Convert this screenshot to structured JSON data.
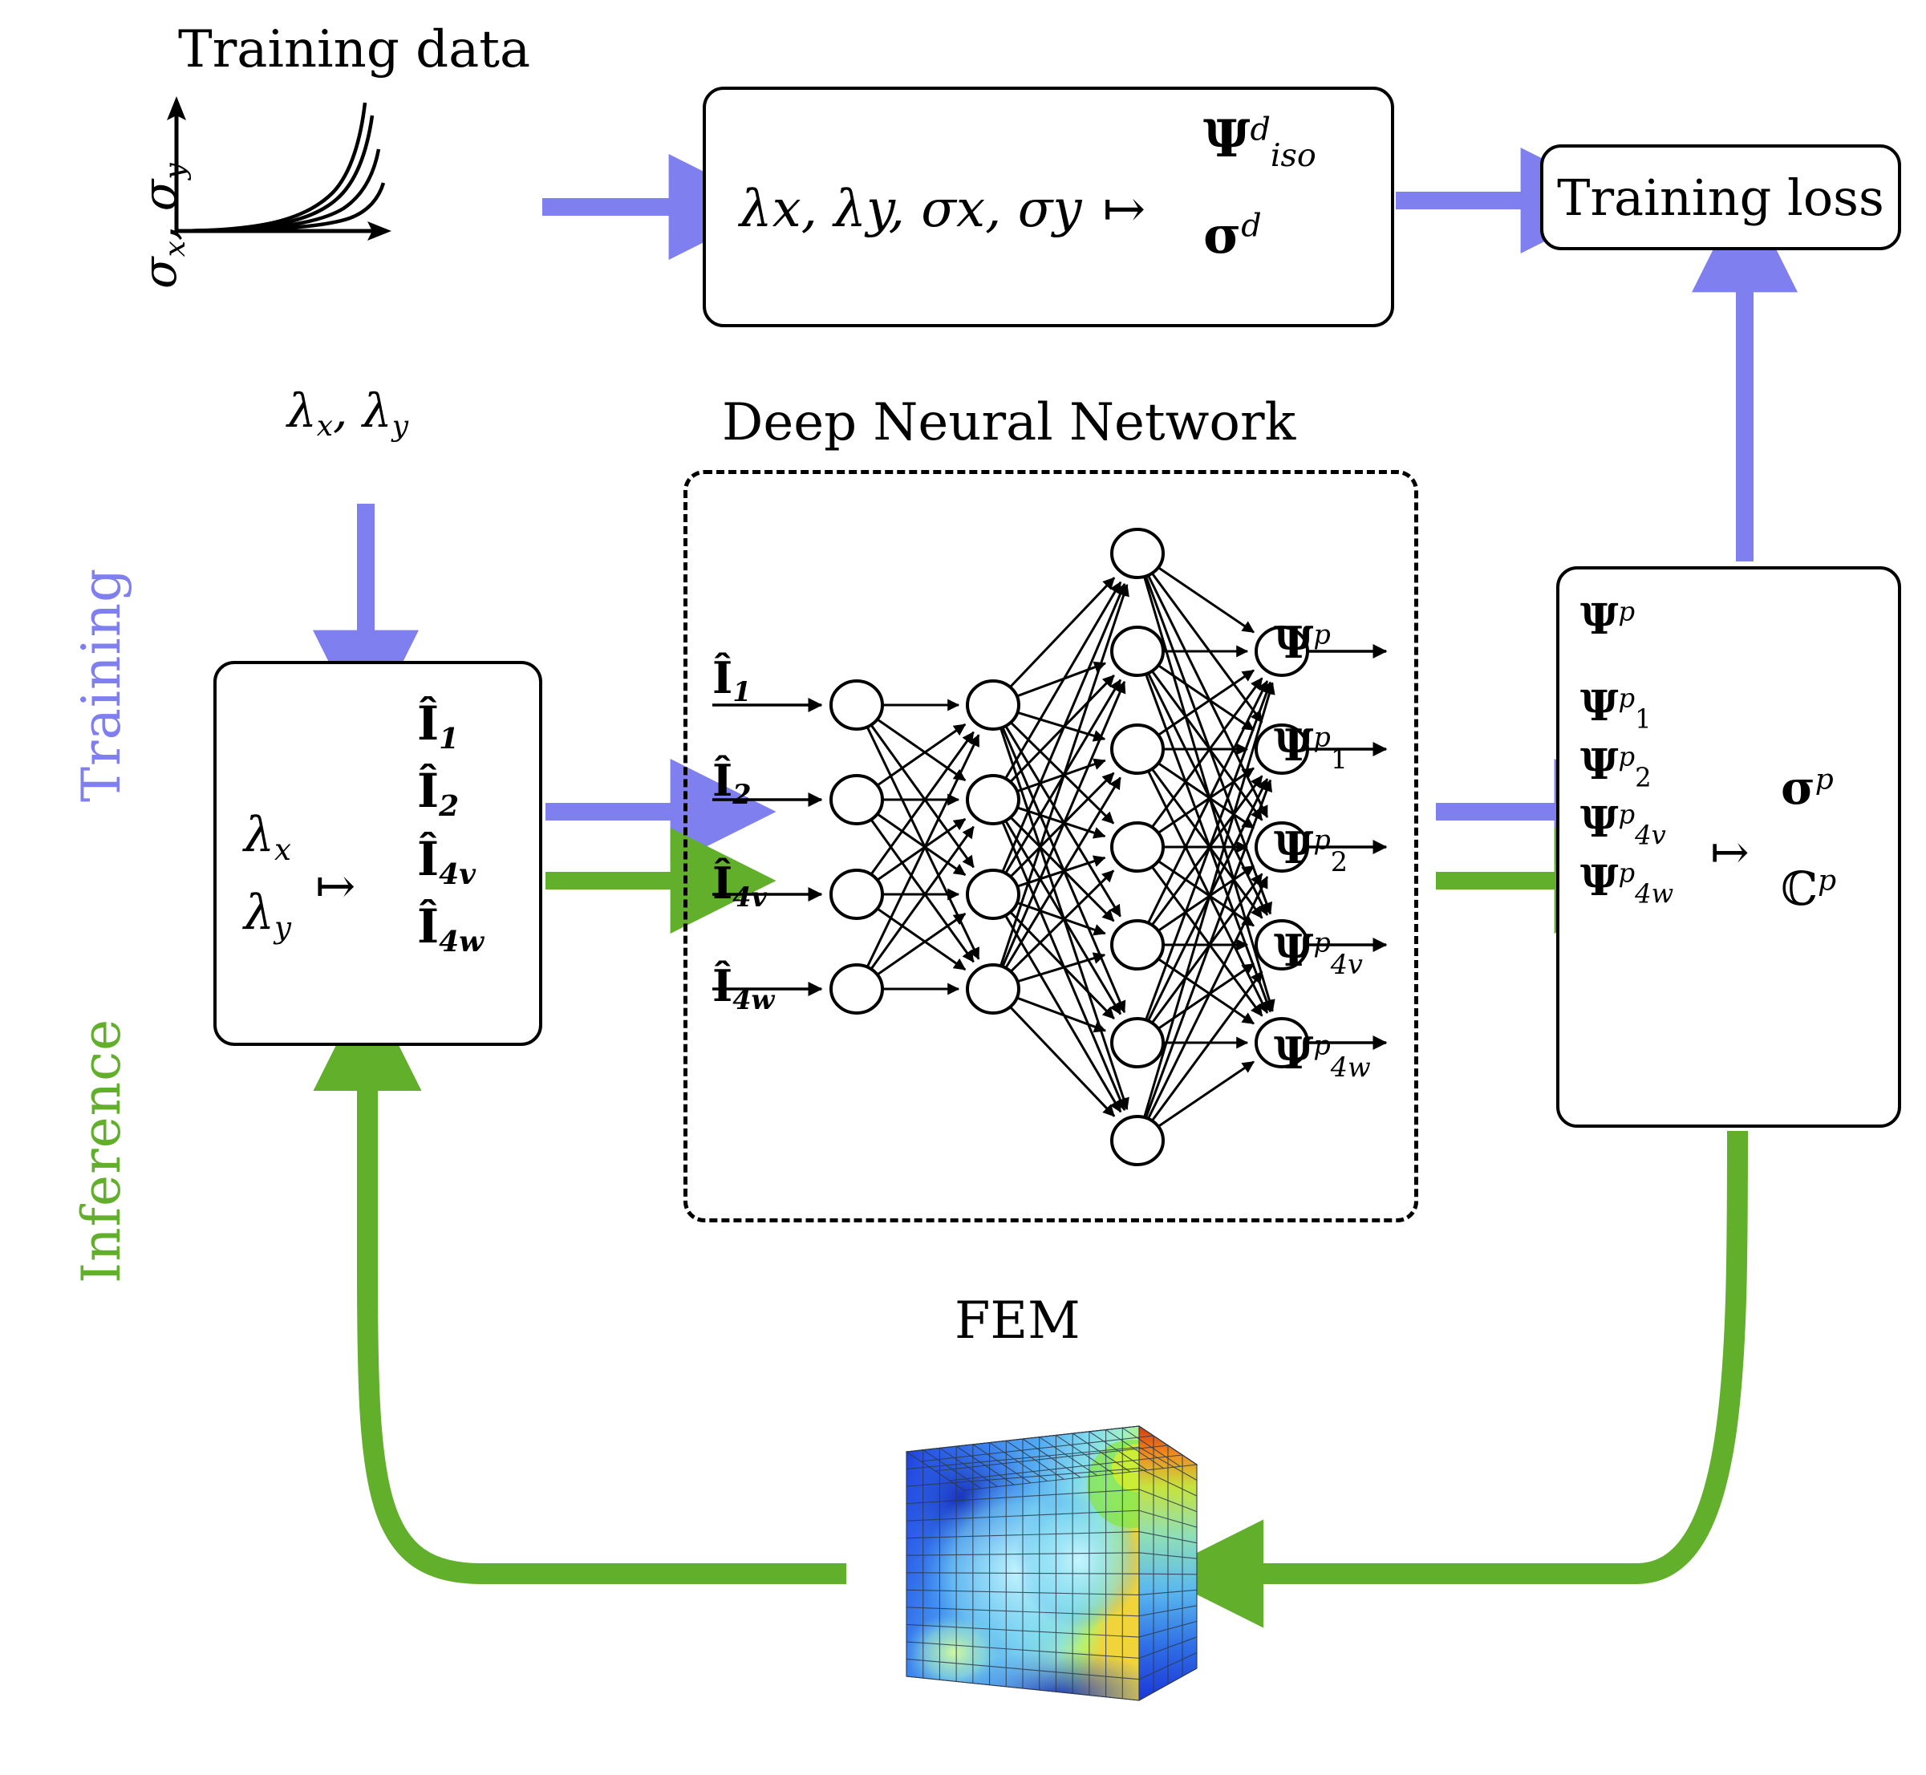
{
  "figure": {
    "phases": {
      "training_label": "Training",
      "inference_label": "Inference",
      "training_color": "#7f7ff0",
      "inference_color": "#62af2c"
    },
    "titles": {
      "training_data": "Training data",
      "deep_neural_network": "Deep Neural Network",
      "fem": "FEM"
    },
    "plot": {
      "ylabel_sigma_x": "σ",
      "ylabel_sigma_x_sub": "x",
      "ylabel_sep": ", ",
      "ylabel_sigma_y": "σ",
      "ylabel_sigma_y_sub": "y",
      "xlabel_lambda_x": "λ",
      "xlabel_lambda_x_sub": "x",
      "xlabel_sep": ", ",
      "xlabel_lambda_y": "λ",
      "xlabel_lambda_y_sub": "y"
    },
    "iso_box": {
      "inputs": "λₓ, λᵧ, σₓ, σᵧ",
      "inputs_plain": "λx, λy, σx, σy",
      "mapsto": "↦",
      "out1_base": "Ψ",
      "out1_sup": "d",
      "out1_sub": "iso",
      "out2_base": "σ",
      "out2_sup": "d"
    },
    "loss_box": {
      "label": "Training loss"
    },
    "invariants_box": {
      "in1_base": "λ",
      "in1_sub": "x",
      "in2_base": "λ",
      "in2_sub": "y",
      "mapsto": "↦",
      "outputs": [
        {
          "base": "Î",
          "sub": "1"
        },
        {
          "base": "Î",
          "sub": "2"
        },
        {
          "base": "Î",
          "sub": "4v"
        },
        {
          "base": "Î",
          "sub": "4w"
        }
      ]
    },
    "network": {
      "input_labels": [
        {
          "base": "Î",
          "sub": "1"
        },
        {
          "base": "Î",
          "sub": "2"
        },
        {
          "base": "Î",
          "sub": "4v"
        },
        {
          "base": "Î",
          "sub": "4w"
        }
      ],
      "output_labels": [
        {
          "base": "Ψ",
          "sup": "p",
          "sub": ""
        },
        {
          "base": "Ψ",
          "sup": "p",
          "sub": "1"
        },
        {
          "base": "Ψ",
          "sup": "p",
          "sub": "2"
        },
        {
          "base": "Ψ",
          "sup": "p",
          "sub": "4v"
        },
        {
          "base": "Ψ",
          "sup": "p",
          "sub": "4w"
        }
      ],
      "layer_sizes": [
        4,
        4,
        7,
        5
      ]
    },
    "stress_box": {
      "inputs": [
        {
          "base": "Ψ",
          "sup": "p",
          "sub": ""
        },
        {
          "base": "Ψ",
          "sup": "p",
          "sub": "1"
        },
        {
          "base": "Ψ",
          "sup": "p",
          "sub": "2"
        },
        {
          "base": "Ψ",
          "sup": "p",
          "sub": "4v"
        },
        {
          "base": "Ψ",
          "sup": "p",
          "sub": "4w"
        }
      ],
      "mapsto": "↦",
      "out1_base": "σ",
      "out1_sup": "p",
      "out2_base": "ℂ",
      "out2_sup": "p"
    }
  }
}
